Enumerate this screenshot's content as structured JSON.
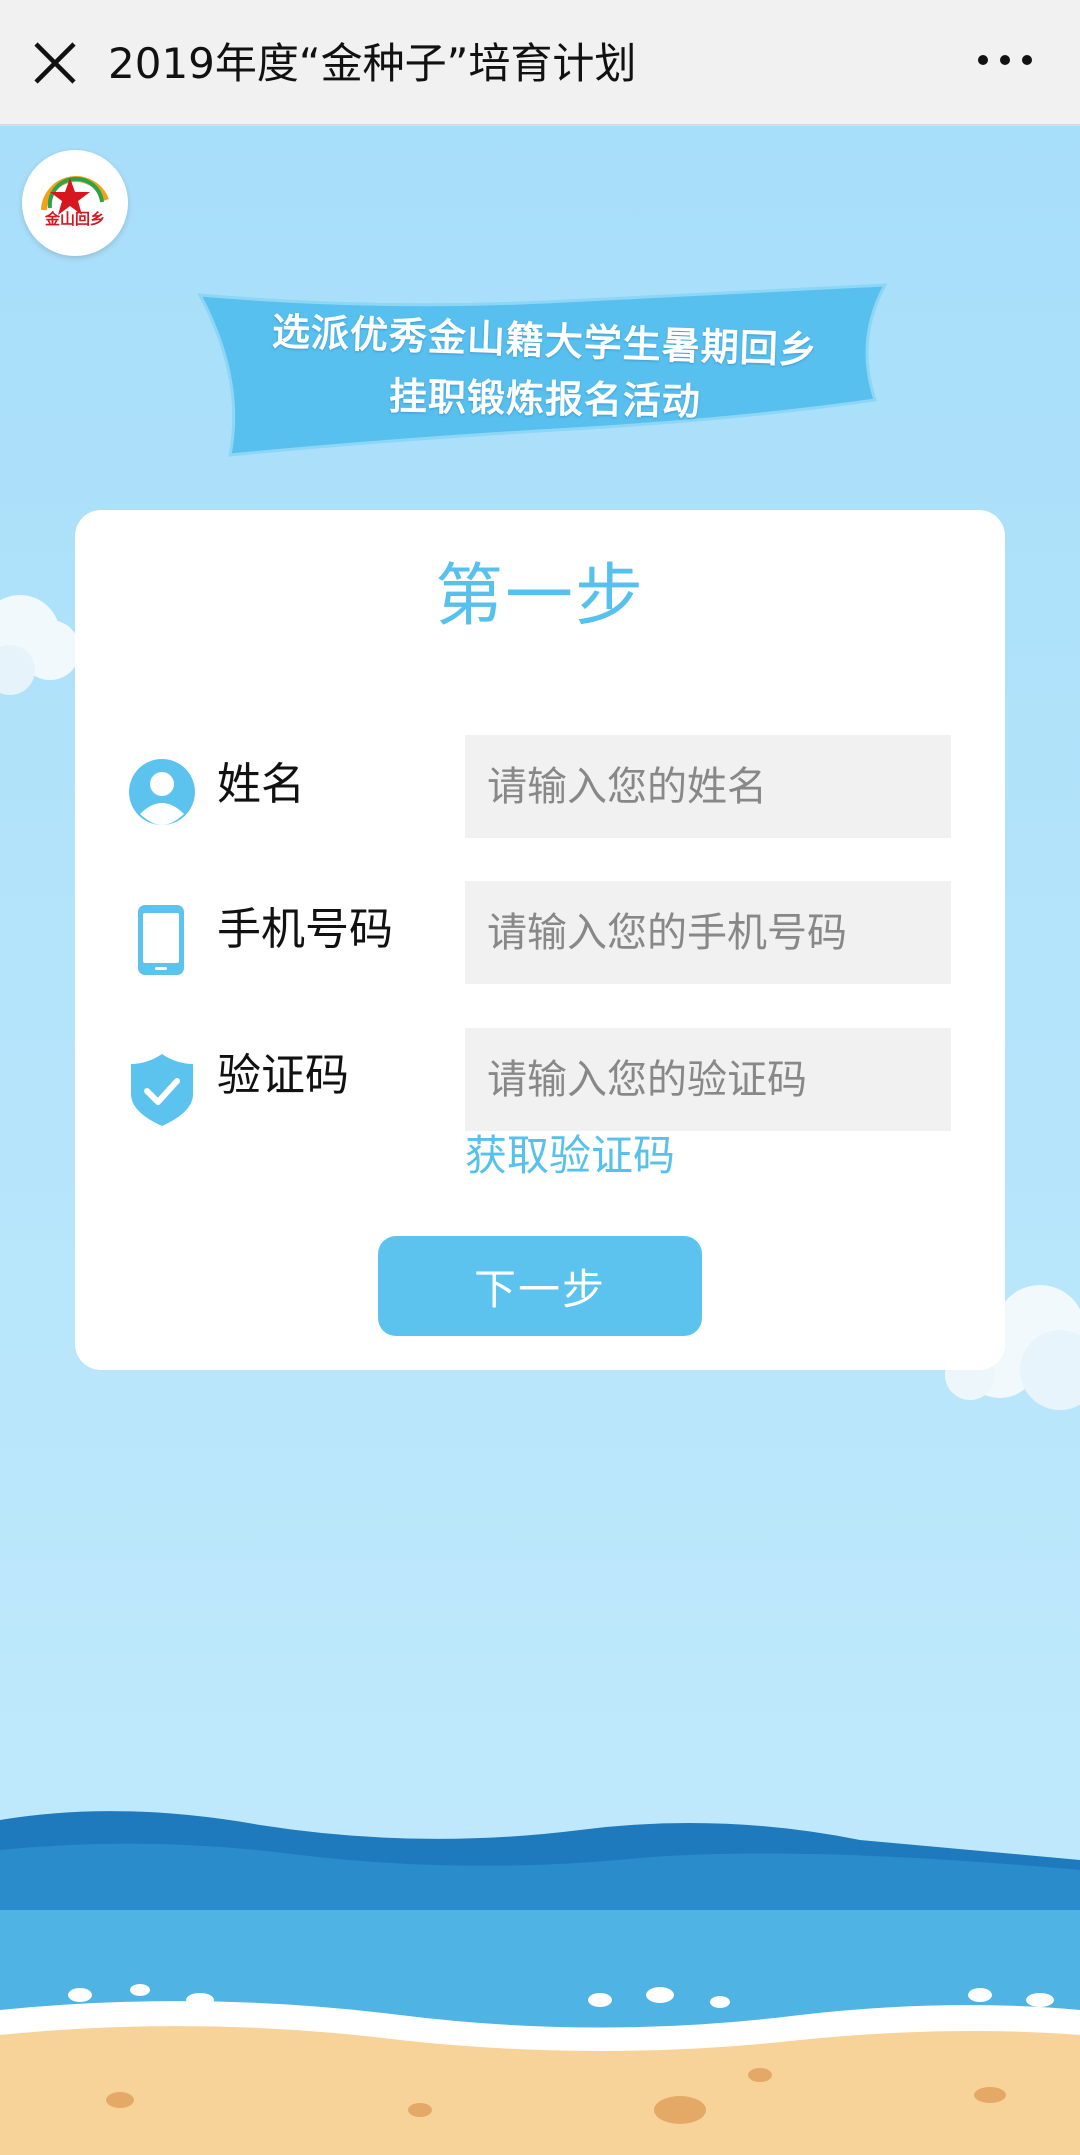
{
  "topbar": {
    "title": "2019年度“金种子”培育计划"
  },
  "logo": {
    "text": "金山回乡"
  },
  "banner": {
    "line1": "选派优秀金山籍大学生暑期回乡",
    "line2": "挂职锻炼报名活动"
  },
  "form": {
    "step_title": "第一步",
    "name": {
      "label": "姓名",
      "placeholder": "请输入您的姓名"
    },
    "phone": {
      "label": "手机号码",
      "placeholder": "请输入您的手机号码"
    },
    "code": {
      "label": "验证码",
      "placeholder": "请输入您的验证码"
    },
    "get_code_label": "获取验证码",
    "next_label": "下一步"
  },
  "colors": {
    "accent": "#56c1ec",
    "button": "#5bc3ee",
    "sky": "#a7defa",
    "sea": "#2f9fd8",
    "sand": "#f7d39a"
  },
  "icons": {
    "close": "close-icon",
    "more": "more-icon",
    "user": "user-icon",
    "phone": "phone-icon",
    "shield": "shield-check-icon"
  }
}
